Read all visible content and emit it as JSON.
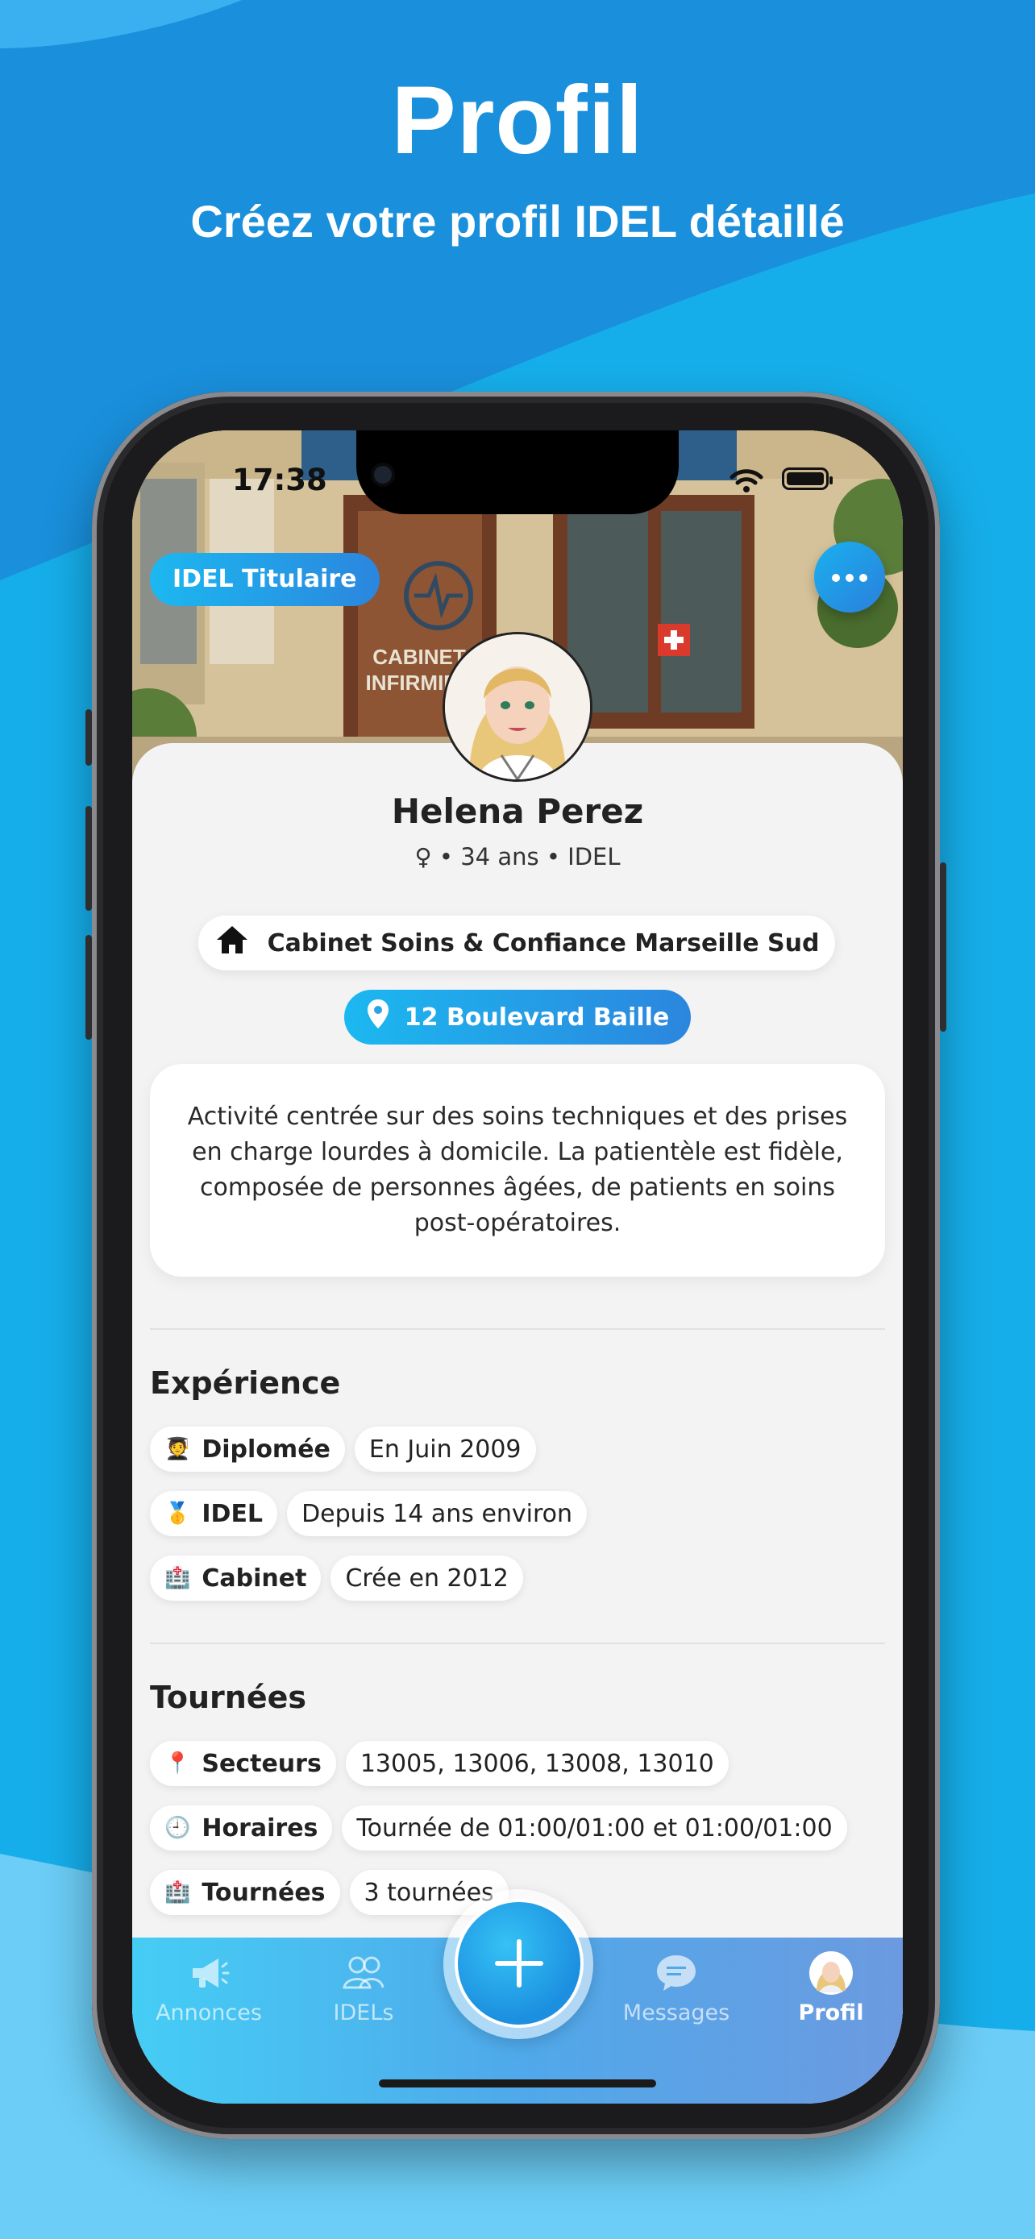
{
  "hero": {
    "title": "Profil",
    "subtitle": "Créez votre profil IDEL détaillé"
  },
  "status_bar": {
    "time": "17:38"
  },
  "profile": {
    "role_badge": "IDEL Titulaire",
    "name": "Helena Perez",
    "meta": "♀ • 34 ans • IDEL",
    "cabinet": "Cabinet Soins & Confiance Marseille Sud",
    "address": "12 Boulevard Baille",
    "description": "Activité centrée sur des soins techniques et des prises en charge lourdes à domicile. La patientèle est fidèle, composée de personnes âgées, de patients en soins post-opératoires."
  },
  "cover": {
    "sign_top": "CABINET INFIRMIER",
    "sign_left": "CABINET",
    "sign_left2": "INFIRMIER"
  },
  "experience": {
    "title": "Expérience",
    "items": [
      {
        "icon": "🧑‍🎓",
        "label": "Diplomée",
        "value": "En Juin 2009"
      },
      {
        "icon": "🥇",
        "label": "IDEL",
        "value": "Depuis 14 ans environ"
      },
      {
        "icon": "🏥",
        "label": "Cabinet",
        "value": "Crée en 2012"
      }
    ]
  },
  "tournees": {
    "title": "Tournées",
    "items": [
      {
        "icon": "📍",
        "label": "Secteurs",
        "value": "13005, 13006, 13008, 13010"
      },
      {
        "icon": "🕘",
        "label": "Horaires",
        "value": "Tournée de 01:00/01:00 et 01:00/01:00"
      },
      {
        "icon": "🏥",
        "label": "Tournées",
        "value": "3 tournées"
      }
    ]
  },
  "tabbar": {
    "items": [
      {
        "label": "Annonces",
        "icon": "megaphone-icon"
      },
      {
        "label": "IDELs",
        "icon": "people-icon"
      },
      {
        "label": "Messages",
        "icon": "chat-bubble-icon"
      },
      {
        "label": "Profil",
        "icon": "avatar-icon"
      }
    ],
    "active": "Profil"
  },
  "colors": {
    "accent_start": "#1cb8f0",
    "accent_end": "#2b86de",
    "background": "#1a97e3"
  }
}
